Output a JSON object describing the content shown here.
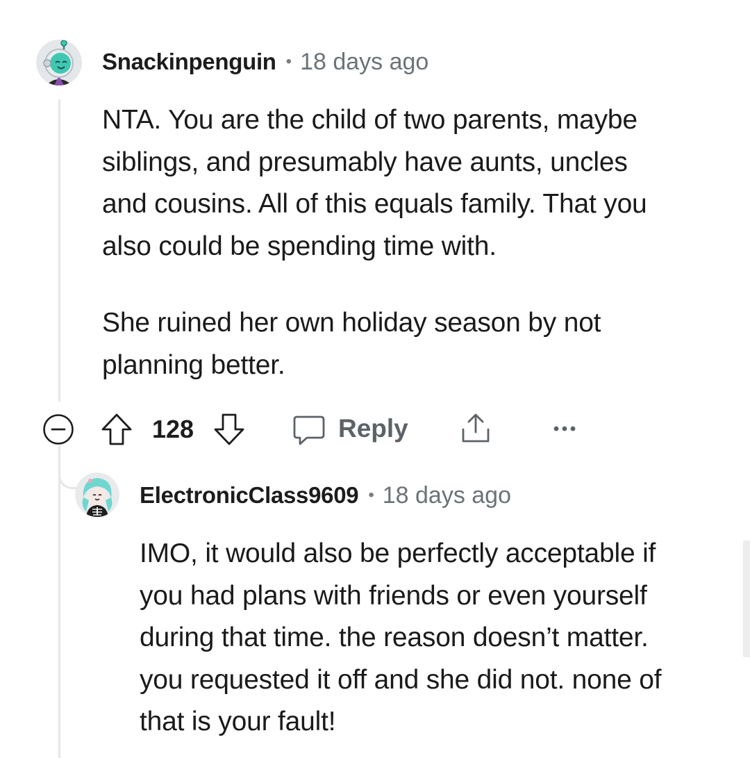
{
  "comments": [
    {
      "username": "Snackinpenguin",
      "separator": "•",
      "timestamp": "18 days ago",
      "avatar_icon": "astronaut-avatar-icon",
      "paragraphs": [
        [
          "NTA. You are the child of two parents, maybe",
          "siblings, and presumably have aunts, uncles",
          "and cousins. All of this equals family. That you",
          "also could be spending time with."
        ],
        [
          "She ruined her own holiday season by not",
          "planning better."
        ]
      ],
      "actions": {
        "collapse_icon": "collapse-minus-icon",
        "upvote_icon": "upvote-arrow-icon",
        "vote_count": "128",
        "downvote_icon": "downvote-arrow-icon",
        "reply_icon": "speech-bubble-icon",
        "reply_label": "Reply",
        "share_icon": "share-icon",
        "more_icon": "more-dots-icon"
      }
    },
    {
      "username": "ElectronicClass9609",
      "separator": "•",
      "timestamp": "18 days ago",
      "avatar_icon": "skeleton-shirt-avatar-icon",
      "paragraphs": [
        [
          "IMO, it would also be perfectly acceptable if",
          "you had plans with friends or even yourself",
          "during that time. the reason doesn’t matter.",
          "you requested it off and she did not. none of",
          "that is your fault!"
        ]
      ]
    }
  ],
  "colors": {
    "text": "#1a1a1b",
    "muted": "#6b7378",
    "thread_line": "#e4e6e8",
    "avatar1_bg": "#dfe3e6",
    "avatar1_accent": "#3ec8b2",
    "avatar2_bg": "#e8eaec",
    "avatar2_hair": "#6fd6d0"
  }
}
